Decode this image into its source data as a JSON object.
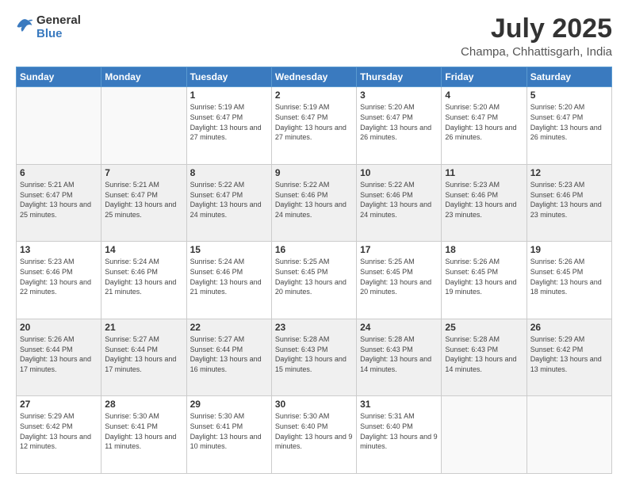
{
  "header": {
    "logo_general": "General",
    "logo_blue": "Blue",
    "month": "July 2025",
    "location": "Champa, Chhattisgarh, India"
  },
  "weekdays": [
    "Sunday",
    "Monday",
    "Tuesday",
    "Wednesday",
    "Thursday",
    "Friday",
    "Saturday"
  ],
  "weeks": [
    [
      {
        "day": null
      },
      {
        "day": null
      },
      {
        "day": 1,
        "sunrise": "5:19 AM",
        "sunset": "6:47 PM",
        "daylight": "13 hours and 27 minutes."
      },
      {
        "day": 2,
        "sunrise": "5:19 AM",
        "sunset": "6:47 PM",
        "daylight": "13 hours and 27 minutes."
      },
      {
        "day": 3,
        "sunrise": "5:20 AM",
        "sunset": "6:47 PM",
        "daylight": "13 hours and 26 minutes."
      },
      {
        "day": 4,
        "sunrise": "5:20 AM",
        "sunset": "6:47 PM",
        "daylight": "13 hours and 26 minutes."
      },
      {
        "day": 5,
        "sunrise": "5:20 AM",
        "sunset": "6:47 PM",
        "daylight": "13 hours and 26 minutes."
      }
    ],
    [
      {
        "day": 6,
        "sunrise": "5:21 AM",
        "sunset": "6:47 PM",
        "daylight": "13 hours and 25 minutes."
      },
      {
        "day": 7,
        "sunrise": "5:21 AM",
        "sunset": "6:47 PM",
        "daylight": "13 hours and 25 minutes."
      },
      {
        "day": 8,
        "sunrise": "5:22 AM",
        "sunset": "6:47 PM",
        "daylight": "13 hours and 24 minutes."
      },
      {
        "day": 9,
        "sunrise": "5:22 AM",
        "sunset": "6:46 PM",
        "daylight": "13 hours and 24 minutes."
      },
      {
        "day": 10,
        "sunrise": "5:22 AM",
        "sunset": "6:46 PM",
        "daylight": "13 hours and 24 minutes."
      },
      {
        "day": 11,
        "sunrise": "5:23 AM",
        "sunset": "6:46 PM",
        "daylight": "13 hours and 23 minutes."
      },
      {
        "day": 12,
        "sunrise": "5:23 AM",
        "sunset": "6:46 PM",
        "daylight": "13 hours and 23 minutes."
      }
    ],
    [
      {
        "day": 13,
        "sunrise": "5:23 AM",
        "sunset": "6:46 PM",
        "daylight": "13 hours and 22 minutes."
      },
      {
        "day": 14,
        "sunrise": "5:24 AM",
        "sunset": "6:46 PM",
        "daylight": "13 hours and 21 minutes."
      },
      {
        "day": 15,
        "sunrise": "5:24 AM",
        "sunset": "6:46 PM",
        "daylight": "13 hours and 21 minutes."
      },
      {
        "day": 16,
        "sunrise": "5:25 AM",
        "sunset": "6:45 PM",
        "daylight": "13 hours and 20 minutes."
      },
      {
        "day": 17,
        "sunrise": "5:25 AM",
        "sunset": "6:45 PM",
        "daylight": "13 hours and 20 minutes."
      },
      {
        "day": 18,
        "sunrise": "5:26 AM",
        "sunset": "6:45 PM",
        "daylight": "13 hours and 19 minutes."
      },
      {
        "day": 19,
        "sunrise": "5:26 AM",
        "sunset": "6:45 PM",
        "daylight": "13 hours and 18 minutes."
      }
    ],
    [
      {
        "day": 20,
        "sunrise": "5:26 AM",
        "sunset": "6:44 PM",
        "daylight": "13 hours and 17 minutes."
      },
      {
        "day": 21,
        "sunrise": "5:27 AM",
        "sunset": "6:44 PM",
        "daylight": "13 hours and 17 minutes."
      },
      {
        "day": 22,
        "sunrise": "5:27 AM",
        "sunset": "6:44 PM",
        "daylight": "13 hours and 16 minutes."
      },
      {
        "day": 23,
        "sunrise": "5:28 AM",
        "sunset": "6:43 PM",
        "daylight": "13 hours and 15 minutes."
      },
      {
        "day": 24,
        "sunrise": "5:28 AM",
        "sunset": "6:43 PM",
        "daylight": "13 hours and 14 minutes."
      },
      {
        "day": 25,
        "sunrise": "5:28 AM",
        "sunset": "6:43 PM",
        "daylight": "13 hours and 14 minutes."
      },
      {
        "day": 26,
        "sunrise": "5:29 AM",
        "sunset": "6:42 PM",
        "daylight": "13 hours and 13 minutes."
      }
    ],
    [
      {
        "day": 27,
        "sunrise": "5:29 AM",
        "sunset": "6:42 PM",
        "daylight": "13 hours and 12 minutes."
      },
      {
        "day": 28,
        "sunrise": "5:30 AM",
        "sunset": "6:41 PM",
        "daylight": "13 hours and 11 minutes."
      },
      {
        "day": 29,
        "sunrise": "5:30 AM",
        "sunset": "6:41 PM",
        "daylight": "13 hours and 10 minutes."
      },
      {
        "day": 30,
        "sunrise": "5:30 AM",
        "sunset": "6:40 PM",
        "daylight": "13 hours and 9 minutes."
      },
      {
        "day": 31,
        "sunrise": "5:31 AM",
        "sunset": "6:40 PM",
        "daylight": "13 hours and 9 minutes."
      },
      {
        "day": null
      },
      {
        "day": null
      }
    ]
  ]
}
